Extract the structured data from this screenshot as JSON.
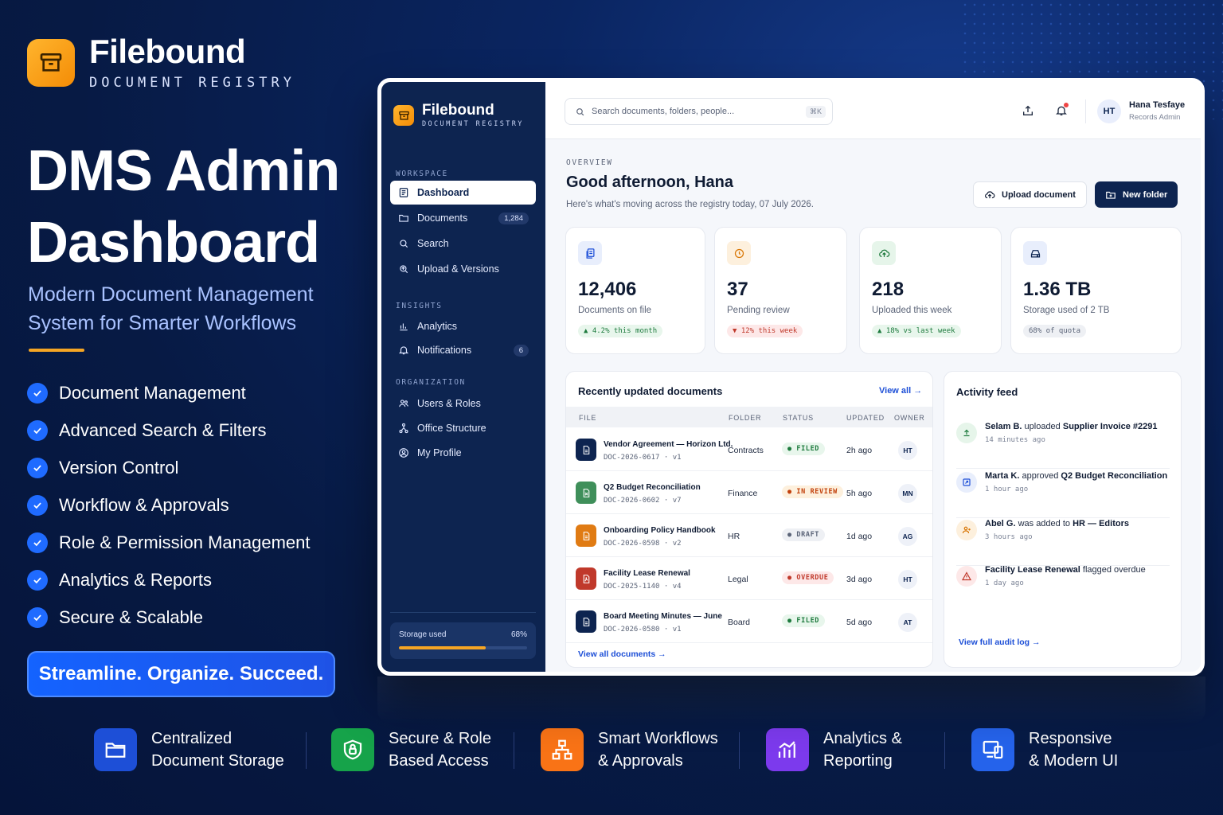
{
  "brand": {
    "name": "Filebound",
    "subtitle": "DOCUMENT REGISTRY"
  },
  "hero": {
    "title": "DMS Admin Dashboard",
    "subtitle": "Modern Document Management System for Smarter Workflows",
    "features": [
      "Document Management",
      "Advanced Search & Filters",
      "Version Control",
      "Workflow & Approvals",
      "Role & Permission Management",
      "Analytics & Reports",
      "Secure & Scalable"
    ],
    "cta": "Streamline. Organize. Succeed."
  },
  "bottom_features": [
    {
      "label": "Centralized\nDocument Storage",
      "icon": "folder-icon",
      "color": "#1d4fd7"
    },
    {
      "label": "Secure & Role\nBased Access",
      "icon": "shield-lock-icon",
      "color": "#16a34a"
    },
    {
      "label": "Smart Workflows\n& Approvals",
      "icon": "workflow-icon",
      "color": "#f97316"
    },
    {
      "label": "Analytics &\nReporting",
      "icon": "bar-chart-icon",
      "color": "#7c3aed"
    },
    {
      "label": "Responsive\n& Modern UI",
      "icon": "devices-icon",
      "color": "#2563eb"
    }
  ],
  "app": {
    "sidebar": {
      "brand": "Filebound",
      "brand_sub": "DOCUMENT REGISTRY",
      "sections": [
        {
          "title": "WORKSPACE",
          "items": [
            {
              "label": "Dashboard",
              "icon": "dashboard-icon",
              "active": true
            },
            {
              "label": "Documents",
              "icon": "folder-icon",
              "badge": "1,284"
            },
            {
              "label": "Search",
              "icon": "search-icon"
            },
            {
              "label": "Upload & Versions",
              "icon": "upload-versions-icon"
            }
          ]
        },
        {
          "title": "INSIGHTS",
          "items": [
            {
              "label": "Analytics",
              "icon": "bar-chart-icon"
            },
            {
              "label": "Notifications",
              "icon": "bell-icon",
              "badge": "6"
            }
          ]
        },
        {
          "title": "ORGANIZATION",
          "items": [
            {
              "label": "Users & Roles",
              "icon": "users-icon"
            },
            {
              "label": "Office Structure",
              "icon": "hierarchy-icon"
            },
            {
              "label": "My Profile",
              "icon": "profile-icon"
            }
          ]
        }
      ],
      "storage": {
        "label": "Storage used",
        "percent_text": "68%",
        "percent": 68
      }
    },
    "topbar": {
      "search_placeholder": "Search documents, folders, people...",
      "shortcut": "⌘K",
      "user": {
        "initials": "HT",
        "name": "Hana Tesfaye",
        "role": "Records Admin"
      }
    },
    "overview": {
      "eyebrow": "OVERVIEW",
      "greeting": "Good afternoon, Hana",
      "subtitle": "Here's what's moving across the registry today, 07 July 2026.",
      "upload_label": "Upload document",
      "new_folder_label": "New folder"
    },
    "stats": [
      {
        "value": "12,406",
        "label": "Documents on file",
        "chip": "▲ 4.2% this month",
        "tone": "up",
        "icon": "documents-icon"
      },
      {
        "value": "37",
        "label": "Pending review",
        "chip": "▼ 12% this week",
        "tone": "down",
        "icon": "clock-icon"
      },
      {
        "value": "218",
        "label": "Uploaded this week",
        "chip": "▲ 18% vs last week",
        "tone": "up",
        "icon": "cloud-upload-icon"
      },
      {
        "value": "1.36 TB",
        "label": "Storage used of 2 TB",
        "chip": "68% of quota",
        "tone": "neutral",
        "icon": "drive-icon"
      }
    ],
    "recent": {
      "title": "Recently updated documents",
      "view_all": "View all →",
      "columns": [
        "FILE",
        "FOLDER",
        "STATUS",
        "UPDATED",
        "OWNER"
      ],
      "rows": [
        {
          "name": "Vendor Agreement — Horizon Ltd.",
          "meta": "DOC-2026-0617 · v1",
          "folder": "Contracts",
          "status": "● FILED",
          "status_tone": "filed",
          "updated": "2h ago",
          "owner": "HT",
          "icon_color": "#0d2450"
        },
        {
          "name": "Q2 Budget Reconciliation",
          "meta": "DOC-2026-0602 · v7",
          "folder": "Finance",
          "status": "● IN REVIEW",
          "status_tone": "review",
          "updated": "5h ago",
          "owner": "MN",
          "icon_color": "#3f8f5a"
        },
        {
          "name": "Onboarding Policy Handbook",
          "meta": "DOC-2026-0598 · v2",
          "folder": "HR",
          "status": "● DRAFT",
          "status_tone": "draft",
          "updated": "1d ago",
          "owner": "AG",
          "icon_color": "#e07b13"
        },
        {
          "name": "Facility Lease Renewal",
          "meta": "DOC-2025-1140 · v4",
          "folder": "Legal",
          "status": "● OVERDUE",
          "status_tone": "overdue",
          "updated": "3d ago",
          "owner": "HT",
          "icon_color": "#c0392b"
        },
        {
          "name": "Board Meeting Minutes — June",
          "meta": "DOC-2026-0580 · v1",
          "folder": "Board",
          "status": "● FILED",
          "status_tone": "filed",
          "updated": "5d ago",
          "owner": "AT",
          "icon_color": "#0d2450"
        }
      ],
      "footer_link": "View all documents →"
    },
    "activity": {
      "title": "Activity feed",
      "items": [
        {
          "actor": "Selam B.",
          "action": " uploaded ",
          "target": "Supplier Invoice #2291",
          "time": "14 minutes ago",
          "icon": "upload-icon",
          "tone": "green"
        },
        {
          "actor": "Marta K.",
          "action": " approved ",
          "target": "Q2 Budget Reconciliation",
          "time": "1 hour ago",
          "icon": "approve-icon",
          "tone": "blue"
        },
        {
          "actor": "Abel G.",
          "action": " was added to ",
          "target": "HR — Editors",
          "time": "3 hours ago",
          "icon": "user-add-icon",
          "tone": "orange"
        },
        {
          "actor": "Facility Lease Renewal",
          "action": " flagged overdue",
          "target": "",
          "time": "1 day ago",
          "icon": "warning-icon",
          "tone": "red"
        }
      ],
      "footer_link": "View full audit log →"
    }
  }
}
